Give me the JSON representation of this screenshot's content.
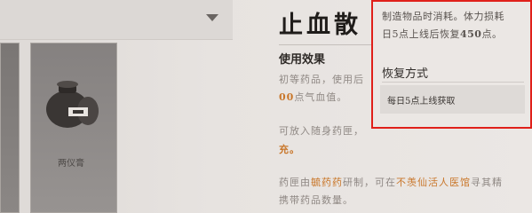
{
  "item": {
    "title": "止血散",
    "slot_name": "两仪膏",
    "effect_heading": "使用效果",
    "effect_line1": "初等药品，使用后",
    "effect_line2_highlight": "00",
    "effect_line2_rest": "点气血值。",
    "note_line1": "可放入随身药匣，",
    "note_line2": "充。",
    "craft_line1_prefix": "药匣由",
    "craft_line1_hl1": "毓药药",
    "craft_line1_mid": "研制，可在",
    "craft_line1_hl2": "不羡仙活人医馆",
    "craft_line1_suffix": "寻其精",
    "craft_line2": "携带药品数量。"
  },
  "popup": {
    "line1": "制造物品时消耗。体力损耗",
    "line2_prefix": "日5点上线后恢复",
    "line2_num": "450",
    "line2_suffix": "点。",
    "recovery_heading": "恢复方式",
    "recovery_method": "每日5点上线获取"
  },
  "icons": {
    "dropdown": "chevron-down-icon",
    "item": "medicine-jar-icon"
  },
  "colors": {
    "highlight": "#c9772b",
    "popup_border": "#e0201a"
  }
}
